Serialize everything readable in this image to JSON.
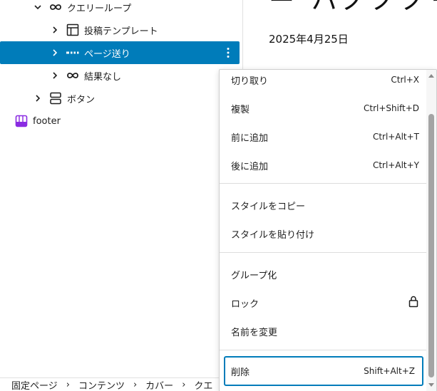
{
  "listview": {
    "items": [
      {
        "label": "クエリーループ",
        "icon": "loop-icon",
        "chevron": "down"
      },
      {
        "label": "投稿テンプレート",
        "icon": "layout-icon",
        "chevron": "right"
      },
      {
        "label": "ページ送り",
        "icon": "pagination-icon",
        "chevron": "right",
        "selected": true
      },
      {
        "label": "結果なし",
        "icon": "loop-icon",
        "chevron": "right"
      },
      {
        "label": "ボタン",
        "icon": "buttons-icon",
        "chevron": "right"
      },
      {
        "label": "footer",
        "icon": "template-part-icon"
      }
    ]
  },
  "canvas": {
    "title_fragment": "ー ハノノノー",
    "date": "2025年4月25日"
  },
  "menu": {
    "items": [
      {
        "label": "切り取り",
        "shortcut": "Ctrl+X"
      },
      {
        "label": "複製",
        "shortcut": "Ctrl+Shift+D"
      },
      {
        "label": "前に追加",
        "shortcut": "Ctrl+Alt+T"
      },
      {
        "label": "後に追加",
        "shortcut": "Ctrl+Alt+Y"
      },
      {
        "label": "スタイルをコピー"
      },
      {
        "label": "スタイルを貼り付け"
      },
      {
        "label": "グループ化"
      },
      {
        "label": "ロック",
        "icon": "lock-icon"
      },
      {
        "label": "名前を変更"
      },
      {
        "label": "削除",
        "shortcut": "Shift+Alt+Z"
      }
    ]
  },
  "breadcrumb": {
    "items": [
      "固定ページ",
      "コンテンツ",
      "カバー",
      "クエ"
    ]
  },
  "colors": {
    "accent": "#007cba",
    "template_part": "#8a2be2"
  }
}
